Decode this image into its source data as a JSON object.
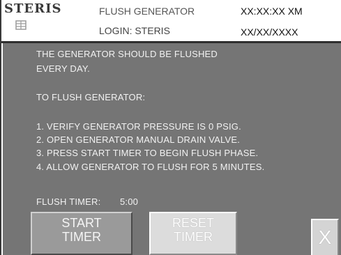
{
  "header": {
    "logo": "STERIS",
    "logo_mark": "®",
    "title": "FLUSH GENERATOR",
    "login": "LOGIN: STERIS",
    "time": "XX:XX:XX XM",
    "date": "XX/XX/XXXX"
  },
  "message": {
    "line1": "THE GENERATOR SHOULD BE FLUSHED",
    "line2": "EVERY DAY.",
    "heading": "TO FLUSH GENERATOR:",
    "steps": [
      "1. VERIFY GENERATOR PRESSURE IS 0 PSIG.",
      "2. OPEN GENERATOR MANUAL DRAIN VALVE.",
      "3. PRESS START TIMER TO BEGIN FLUSH PHASE.",
      "4. ALLOW GENERATOR TO FLUSH FOR 5 MINUTES."
    ]
  },
  "timer": {
    "label": "FLUSH TIMER:",
    "value": "5:00"
  },
  "buttons": {
    "start": [
      "START",
      "TIMER"
    ],
    "reset": [
      "RESET",
      "TIMER"
    ],
    "close": "X"
  }
}
